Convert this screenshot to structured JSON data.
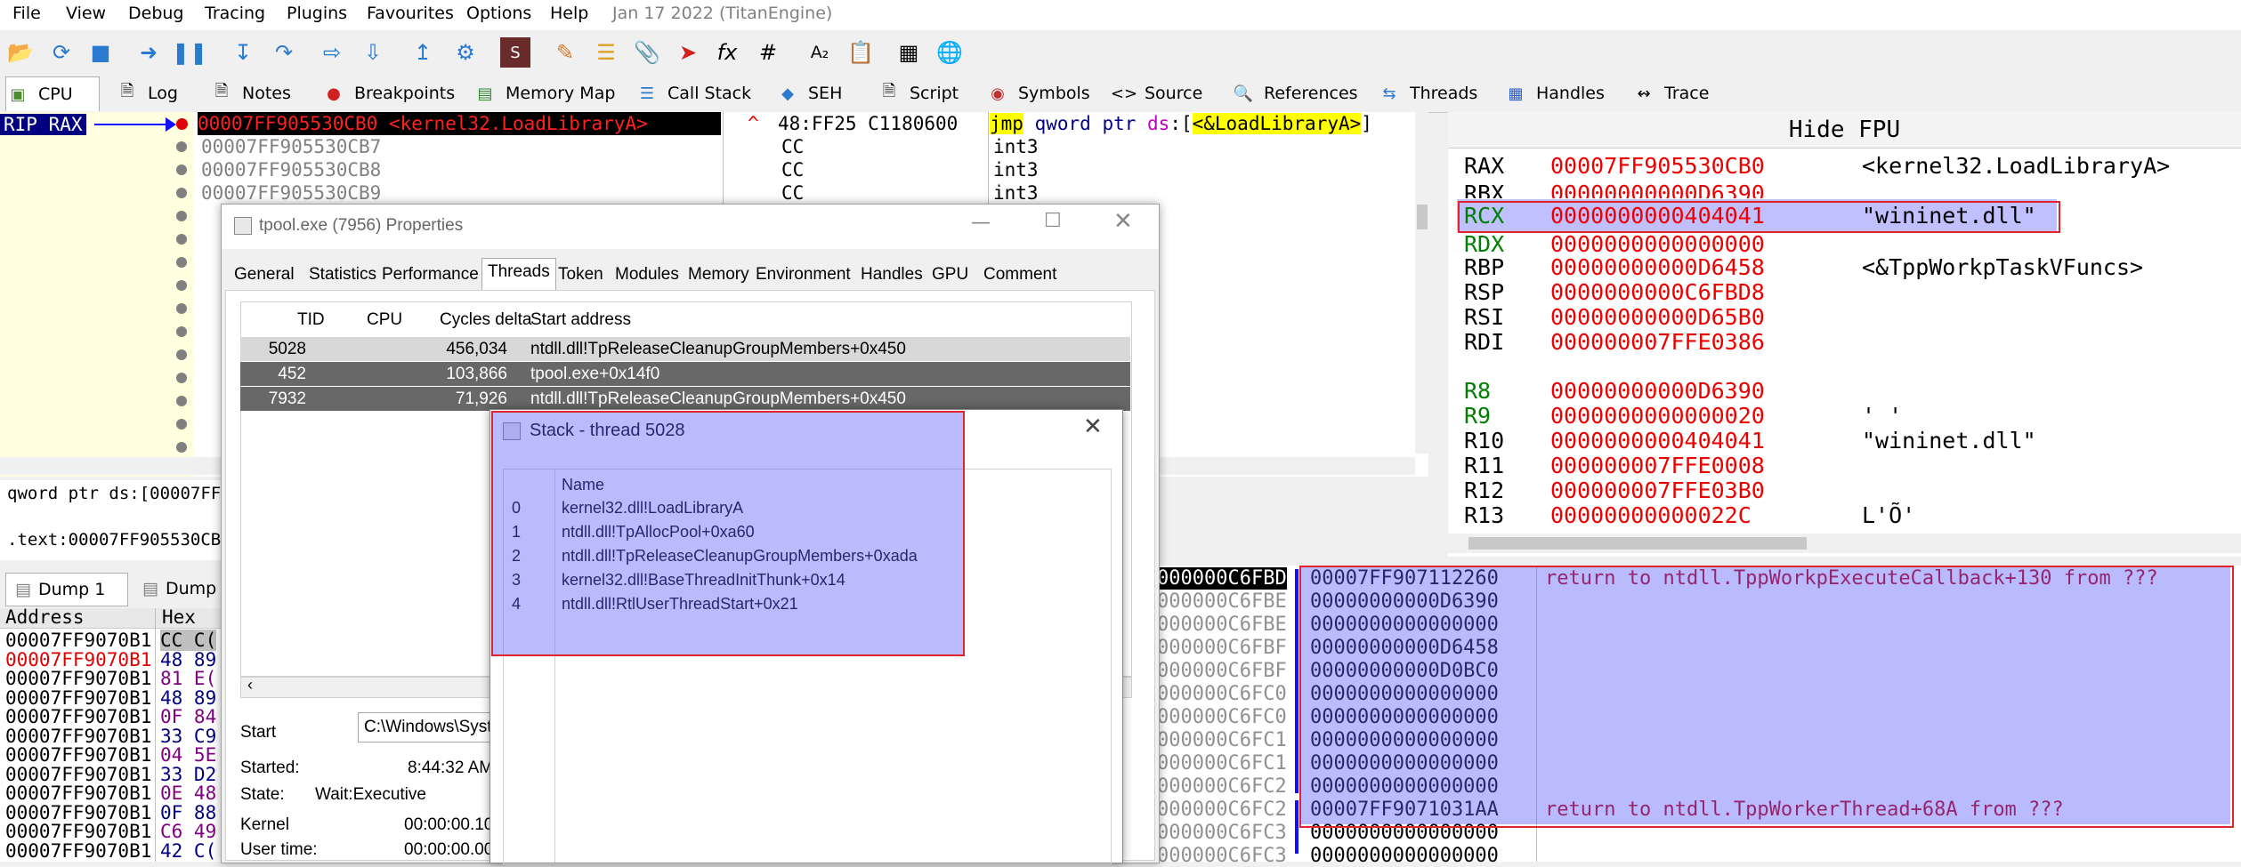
{
  "menu": {
    "items": [
      "File",
      "View",
      "Debug",
      "Tracing",
      "Plugins",
      "Favourites",
      "Options",
      "Help"
    ],
    "date": "Jan 17 2022 (TitanEngine)"
  },
  "tabs": [
    "CPU",
    "Log",
    "Notes",
    "Breakpoints",
    "Memory Map",
    "Call Stack",
    "SEH",
    "Script",
    "Symbols",
    "Source",
    "References",
    "Threads",
    "Handles",
    "Trace"
  ],
  "disasm": {
    "rip_label": "RIP RAX",
    "rows": [
      {
        "addr": "00007FF905530CB0 <kernel32.LoadLibraryA>",
        "bytes": "48:FF25 C1180600",
        "instr": "jmp qword ptr ds:[<&LoadLibraryA>]"
      },
      {
        "addr": "00007FF905530CB7",
        "bytes": "CC",
        "instr": "int3"
      },
      {
        "addr": "00007FF905530CB8",
        "bytes": "CC",
        "instr": "int3"
      },
      {
        "addr": "00007FF905530CB9",
        "bytes": "CC",
        "instr": "int3"
      }
    ],
    "jmp_prefix": "jmp qword ptr ",
    "ds": "ds",
    "colon": ":[",
    "target": "<&LoadLibraryA>",
    "close": "]"
  },
  "info": {
    "line1": "qword ptr ds:[00007FF9",
    "line2": ".text:00007FF905530CB0"
  },
  "registers": {
    "hide_fpu": "Hide FPU",
    "rows": [
      {
        "name": "RAX",
        "value": "00007FF905530CB0",
        "comment": "<kernel32.LoadLibraryA>"
      },
      {
        "name": "RBX",
        "value": "00000000000D6390",
        "comment": ""
      },
      {
        "name": "RCX",
        "value": "0000000000404041",
        "comment": "\"wininet.dll\""
      },
      {
        "name": "RDX",
        "value": "0000000000000000",
        "comment": ""
      },
      {
        "name": "RBP",
        "value": "00000000000D6458",
        "comment": "<&TppWorkpTaskVFuncs>"
      },
      {
        "name": "RSP",
        "value": "0000000000C6FBD8",
        "comment": ""
      },
      {
        "name": "RSI",
        "value": "00000000000D65B0",
        "comment": ""
      },
      {
        "name": "RDI",
        "value": "000000007FFE0386",
        "comment": ""
      },
      {
        "name": "R8",
        "value": "00000000000D6390",
        "comment": "' '"
      },
      {
        "name": "R9",
        "value": "0000000000000020",
        "comment": "' '"
      },
      {
        "name": "R10",
        "value": "0000000000404041",
        "comment": "\"wininet.dll\""
      },
      {
        "name": "R11",
        "value": "000000007FFE0008",
        "comment": ""
      },
      {
        "name": "R12",
        "value": "000000007FFE03B0",
        "comment": ""
      },
      {
        "name": "R13",
        "value": "00000000000022C",
        "comment": "L'Õ'"
      }
    ]
  },
  "dump": {
    "tabs": [
      "Dump 1",
      "Dump"
    ],
    "header_addr": "Address",
    "header_hex": "Hex",
    "rows": [
      {
        "addr": "00007FF9070B1",
        "hex": "CC C("
      },
      {
        "addr": "00007FF9070B1",
        "hex": "48 89"
      },
      {
        "addr": "00007FF9070B1",
        "hex": "81 E("
      },
      {
        "addr": "00007FF9070B1",
        "hex": "48 89"
      },
      {
        "addr": "00007FF9070B1",
        "hex": "0F 84"
      },
      {
        "addr": "00007FF9070B1",
        "hex": "33 C9"
      },
      {
        "addr": "00007FF9070B1",
        "hex": "04 5E"
      },
      {
        "addr": "00007FF9070B1",
        "hex": "33 D2"
      },
      {
        "addr": "00007FF9070B1",
        "hex": "0E 48"
      },
      {
        "addr": "00007FF9070B1",
        "hex": "0F 88"
      },
      {
        "addr": "00007FF9070B1",
        "hex": "C6 49"
      },
      {
        "addr": "00007FF9070B1",
        "hex": "42 C("
      }
    ]
  },
  "stack": {
    "rows": [
      {
        "addr": "000000C6FBD",
        "val": "00007FF907112260",
        "comment": "return to ntdll.TppWorkpExecuteCallback+130 from ???"
      },
      {
        "addr": "000000C6FBE",
        "val": "00000000000D6390",
        "comment": ""
      },
      {
        "addr": "000000C6FBE",
        "val": "0000000000000000",
        "comment": ""
      },
      {
        "addr": "000000C6FBF",
        "val": "00000000000D6458",
        "comment": ""
      },
      {
        "addr": "000000C6FBF",
        "val": "00000000000D0BC0",
        "comment": ""
      },
      {
        "addr": "000000C6FC0",
        "val": "0000000000000000",
        "comment": ""
      },
      {
        "addr": "000000C6FC0",
        "val": "0000000000000000",
        "comment": ""
      },
      {
        "addr": "000000C6FC1",
        "val": "0000000000000000",
        "comment": ""
      },
      {
        "addr": "000000C6FC1",
        "val": "0000000000000000",
        "comment": ""
      },
      {
        "addr": "000000C6FC2",
        "val": "0000000000000000",
        "comment": ""
      },
      {
        "addr": "000000C6FC2",
        "val": "00007FF9071031AA",
        "comment": "return to ntdll.TppWorkerThread+68A from ???"
      },
      {
        "addr": "000000C6FC3",
        "val": "0000000000000000",
        "comment": ""
      },
      {
        "addr": "000000C6FC3",
        "val": "0000000000000000",
        "comment": ""
      }
    ]
  },
  "properties": {
    "title": "tpool.exe (7956) Properties",
    "tabs": [
      "General",
      "Statistics",
      "Performance",
      "Threads",
      "Token",
      "Modules",
      "Memory",
      "Environment",
      "Handles",
      "GPU",
      "Comment"
    ],
    "columns": [
      "TID",
      "CPU",
      "Cycles delta",
      "Start address"
    ],
    "rows": [
      {
        "tid": "5028",
        "cpu": "",
        "cycles": "456,034",
        "start": "ntdll.dll!TpReleaseCleanupGroupMembers+0x450"
      },
      {
        "tid": "452",
        "cpu": "",
        "cycles": "103,866",
        "start": "tpool.exe+0x14f0"
      },
      {
        "tid": "7932",
        "cpu": "",
        "cycles": "71,926",
        "start": "ntdll.dll!TpReleaseCleanupGroupMembers+0x450"
      }
    ],
    "start_label": "Start",
    "start_value": "C:\\Windows\\Syst",
    "started_label": "Started:",
    "started_value": "8:44:32 AM",
    "state_label": "State:",
    "state_value": "Wait:Executive",
    "kernel_label": "Kernel",
    "kernel_value": "00:00:00.10",
    "user_label": "User time:",
    "user_value": "00:00:00.00"
  },
  "stack_dialog": {
    "title": "Stack - thread 5028",
    "column": "Name",
    "frames": [
      {
        "idx": "0",
        "name": "kernel32.dll!LoadLibraryA"
      },
      {
        "idx": "1",
        "name": "ntdll.dll!TpAllocPool+0xa60"
      },
      {
        "idx": "2",
        "name": "ntdll.dll!TpReleaseCleanupGroupMembers+0xada"
      },
      {
        "idx": "3",
        "name": "kernel32.dll!BaseThreadInitThunk+0x14"
      },
      {
        "idx": "4",
        "name": "ntdll.dll!RtlUserThreadStart+0x21"
      }
    ]
  },
  "colors": {
    "accent_red": "#e0242e",
    "overlay_blue": "#5a5aff",
    "reg_changed": "#ff0000",
    "reg_green": "#008000"
  }
}
